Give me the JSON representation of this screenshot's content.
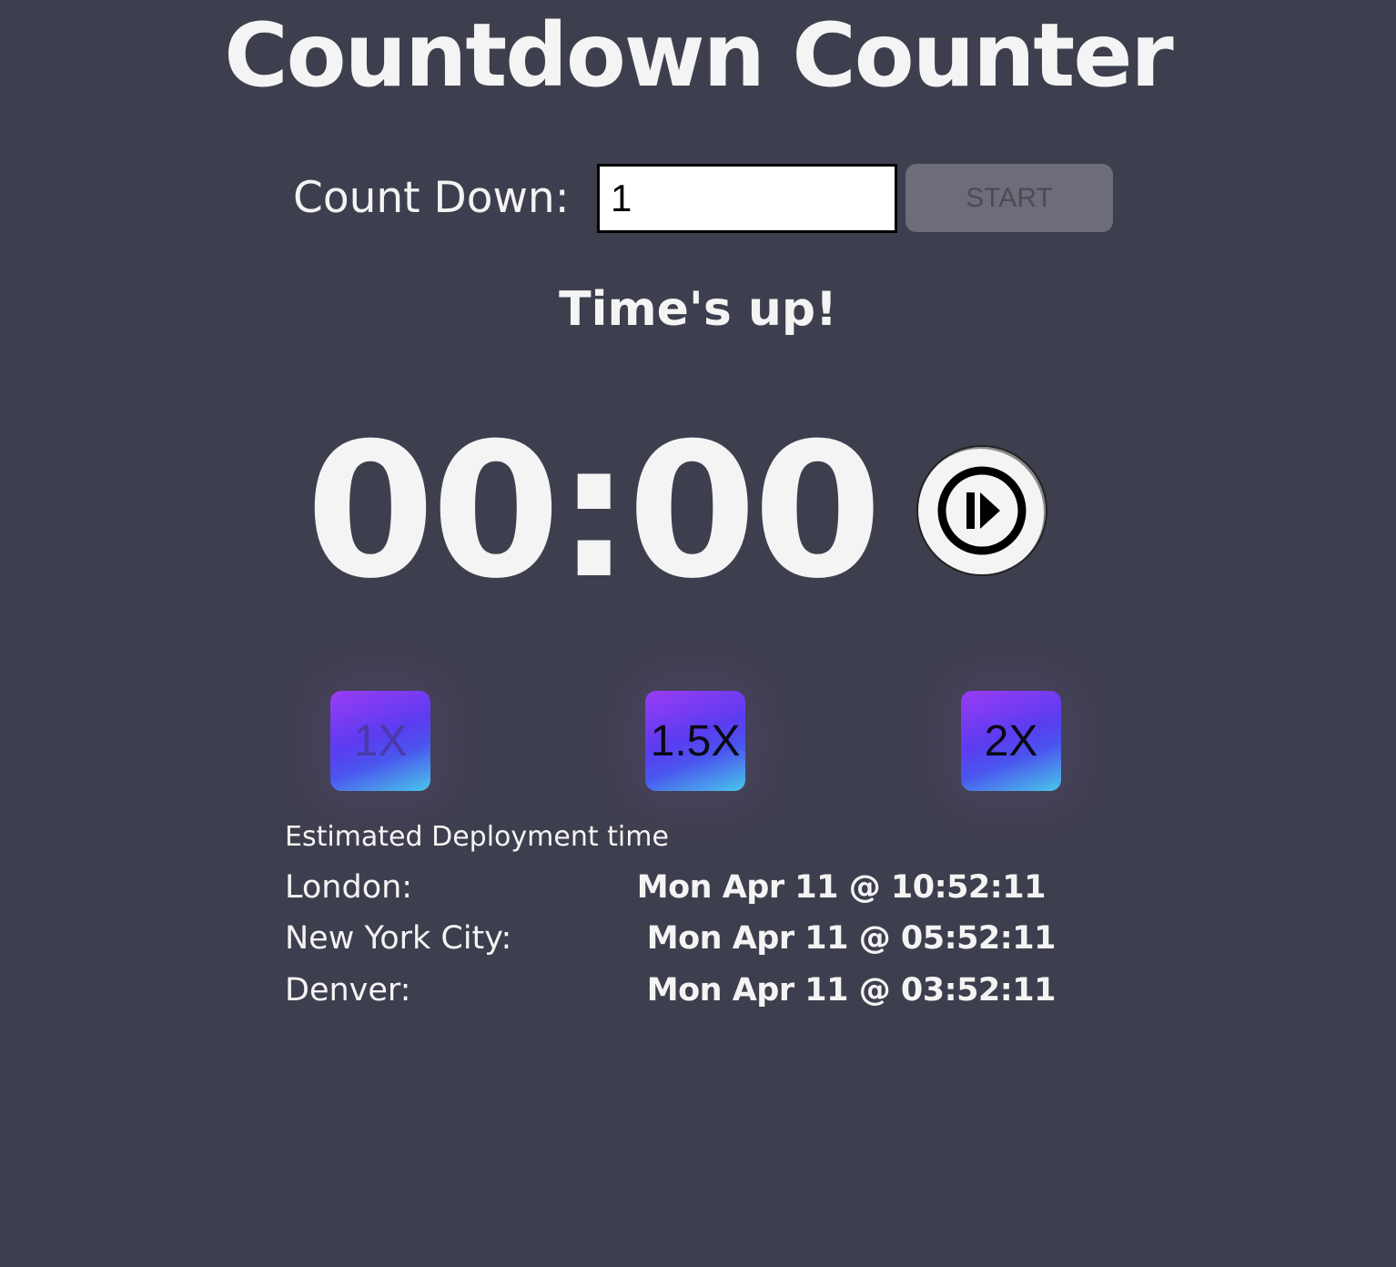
{
  "page": {
    "title": "Countdown Counter"
  },
  "countdown_form": {
    "label": "Count Down:",
    "input_value": "1",
    "start_label": "START"
  },
  "status": {
    "message": "Time's up!"
  },
  "timer": {
    "display": "00:00",
    "control_icon": "play-pause-icon"
  },
  "speed": {
    "options": [
      {
        "label": "1X",
        "active": true
      },
      {
        "label": "1.5X",
        "active": false
      },
      {
        "label": "2X",
        "active": false
      }
    ]
  },
  "deployment": {
    "heading": "Estimated Deployment time",
    "cities": [
      {
        "name": "London:",
        "time": "Mon Apr 11 @ 10:52:11"
      },
      {
        "name": "New York City:",
        "time": "Mon Apr 11 @ 05:52:11"
      },
      {
        "name": "Denver:",
        "time": "Mon Apr 11 @ 03:52:11"
      }
    ]
  },
  "colors": {
    "background": "#3e3f4e",
    "text": "#f4f4f4",
    "start_button": "#6c6d78",
    "speed_gradient_start": "#9a3cf5",
    "speed_gradient_end": "#49c7ea"
  }
}
